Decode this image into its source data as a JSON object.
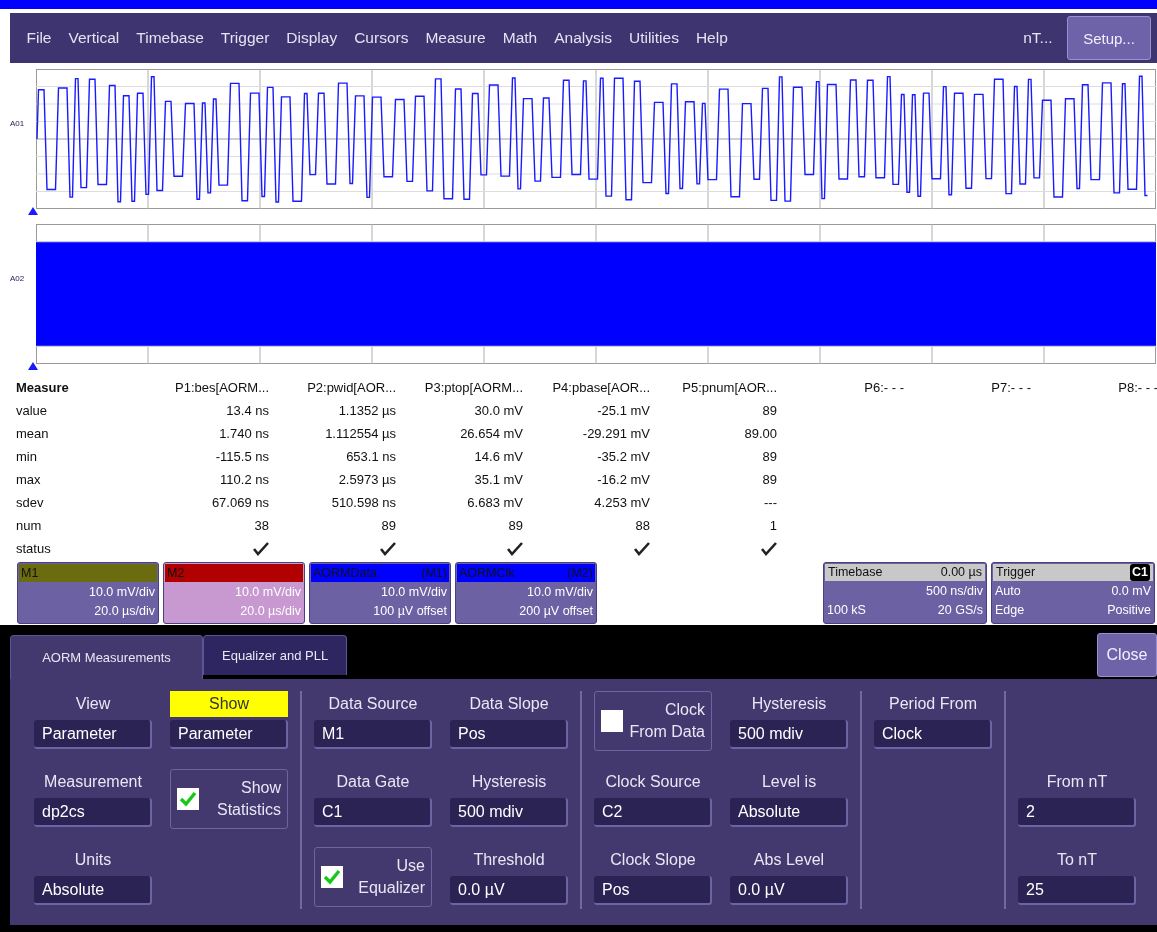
{
  "menu": {
    "items": [
      "File",
      "Vertical",
      "Timebase",
      "Trigger",
      "Display",
      "Cursors",
      "Measure",
      "Math",
      "Analysis",
      "Utilities",
      "Help"
    ],
    "overflow": "nT...",
    "setup_button": "Setup..."
  },
  "traces": [
    {
      "label": "A01",
      "kind": "square"
    },
    {
      "label": "A02",
      "kind": "dense"
    }
  ],
  "measure": {
    "heading": "Measure",
    "columns": [
      "P1:bes[AORM...",
      "P2:pwid[AOR...",
      "P3:ptop[AORM...",
      "P4:pbase[AOR...",
      "P5:pnum[AOR...",
      "P6:- - -",
      "P7:- - -",
      "P8:- - -"
    ],
    "rows": [
      {
        "label": "value",
        "cells": [
          "13.4 ns",
          "1.1352 µs",
          "30.0 mV",
          "-25.1 mV",
          "89"
        ]
      },
      {
        "label": "mean",
        "cells": [
          "1.740 ns",
          "1.112554 µs",
          "26.654 mV",
          "-29.291 mV",
          "89.00"
        ]
      },
      {
        "label": "min",
        "cells": [
          "-115.5 ns",
          "653.1 ns",
          "14.6 mV",
          "-35.2 mV",
          "89"
        ]
      },
      {
        "label": "max",
        "cells": [
          "110.2 ns",
          "2.5973 µs",
          "35.1 mV",
          "-16.2 mV",
          "89"
        ]
      },
      {
        "label": "sdev",
        "cells": [
          "67.069 ns",
          "510.598 ns",
          "6.683 mV",
          "4.253 mV",
          "---"
        ]
      },
      {
        "label": "num",
        "cells": [
          "38",
          "89",
          "89",
          "88",
          "1"
        ]
      }
    ],
    "status": {
      "label": "status",
      "checks": [
        true,
        true,
        true,
        true,
        true
      ]
    }
  },
  "descriptors": [
    {
      "title": "M1",
      "line_1": "10.0 mV/div",
      "line_2": "20.0 µs/div",
      "color": "#6b6b10",
      "selected": false
    },
    {
      "title": "M2",
      "line_1": "10.0 mV/div",
      "line_2": "20.0 µs/div",
      "color": "#b00000",
      "selected": true
    },
    {
      "title": "AORMData",
      "source": "(M1)",
      "line_1": "10.0 mV/div",
      "line_2": "100 µV offset",
      "color": "#0000ff",
      "selected": false
    },
    {
      "title": "AORMClk",
      "source": "(M2)",
      "line_1": "10.0 mV/div",
      "line_2": "200 µV offset",
      "color": "#0000ff",
      "selected": false
    }
  ],
  "timebase": {
    "title": "Timebase",
    "delay": "0.00 µs",
    "per_div": "500 ns/div",
    "samples": "100 kS",
    "rate": "20 GS/s"
  },
  "trigger": {
    "title": "Trigger",
    "channel": "C1",
    "mode": "Auto",
    "level": "0.0 mV",
    "type": "Edge",
    "slope": "Positive"
  },
  "dialog": {
    "tabs": [
      {
        "label": "AORM Measurements",
        "selected": true
      },
      {
        "label": "Equalizer and PLL",
        "selected": false
      }
    ],
    "close_button": "Close",
    "sections": [
      [
        [
          {
            "kind": "field",
            "label": "View",
            "value": "Parameter",
            "highlighted": false
          },
          {
            "kind": "field",
            "label": "Measurement",
            "value": "dp2cs",
            "highlighted": false
          },
          {
            "kind": "field",
            "label": "Units",
            "value": "Absolute",
            "highlighted": false
          }
        ],
        [
          {
            "kind": "field",
            "label": "Show",
            "value": "Parameter",
            "highlighted": true
          },
          {
            "kind": "checkbox",
            "lines": [
              "Show",
              "Statistics"
            ],
            "checked": true
          },
          {
            "kind": "blank"
          }
        ]
      ],
      [
        [
          {
            "kind": "field",
            "label": "Data Source",
            "value": "M1",
            "highlighted": false
          },
          {
            "kind": "field",
            "label": "Data Gate",
            "value": "C1",
            "highlighted": false
          },
          {
            "kind": "checkbox",
            "lines": [
              "Use",
              "Equalizer"
            ],
            "checked": true
          }
        ],
        [
          {
            "kind": "field",
            "label": "Data Slope",
            "value": "Pos",
            "highlighted": false
          },
          {
            "kind": "field",
            "label": "Hysteresis",
            "value": "500 mdiv",
            "highlighted": false
          },
          {
            "kind": "field",
            "label": "Threshold",
            "value": "0.0 µV",
            "highlighted": false
          }
        ]
      ],
      [
        [
          {
            "kind": "checkbox",
            "lines": [
              "Clock",
              "From Data"
            ],
            "checked": false
          },
          {
            "kind": "field",
            "label": "Clock Source",
            "value": "C2",
            "highlighted": false
          },
          {
            "kind": "field",
            "label": "Clock Slope",
            "value": "Pos",
            "highlighted": false
          }
        ],
        [
          {
            "kind": "field",
            "label": "Hysteresis",
            "value": "500 mdiv",
            "highlighted": false
          },
          {
            "kind": "field",
            "label": "Level is",
            "value": "Absolute",
            "highlighted": false
          },
          {
            "kind": "field",
            "label": "Abs Level",
            "value": "0.0 µV",
            "highlighted": false
          }
        ]
      ],
      [
        [
          {
            "kind": "field",
            "label": "Period From",
            "value": "Clock",
            "highlighted": false
          },
          {
            "kind": "blank"
          },
          {
            "kind": "blank"
          }
        ]
      ],
      [
        [
          {
            "kind": "blank"
          },
          {
            "kind": "field",
            "label": "From nT",
            "value": "2",
            "highlighted": false
          },
          {
            "kind": "field",
            "label": "To nT",
            "value": "25",
            "highlighted": false
          }
        ]
      ]
    ]
  }
}
